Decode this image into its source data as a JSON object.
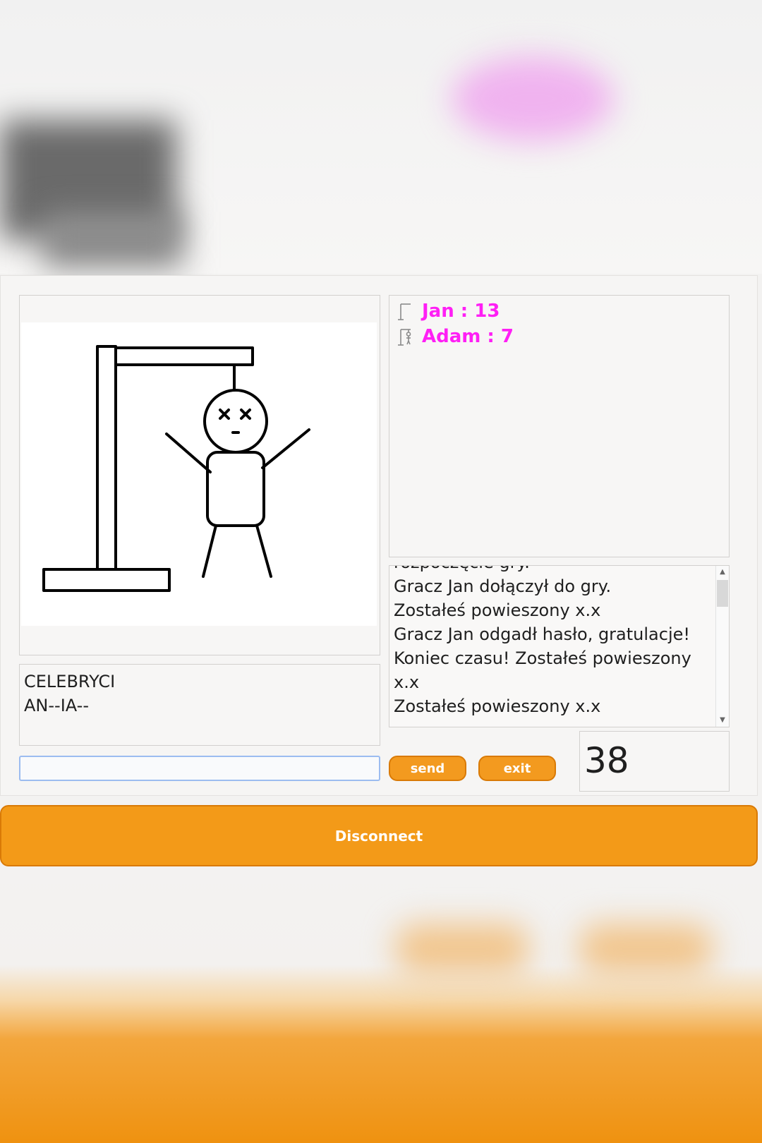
{
  "players": [
    {
      "label": "Jan : 13",
      "icon": "gallows-icon"
    },
    {
      "label": "Adam : 7",
      "icon": "hanged-man-icon"
    }
  ],
  "game_log": [
    "rozpoczęcie gry.",
    "Gracz Jan dołączył do gry.",
    "Zostałeś powieszony x.x",
    "Gracz Jan odgadł hasło, gratulacje!",
    "Koniec czasu! Zostałeś powieszony",
    "x.x",
    "Zostałeś powieszony x.x"
  ],
  "word": {
    "category": "CELEBRYCI",
    "pattern": "AN--IA--"
  },
  "controls": {
    "send_label": "send",
    "exit_label": "exit",
    "guess_value": ""
  },
  "timer": "38",
  "disconnect_label": "Disconnect",
  "colors": {
    "accent": "#f39a18",
    "player_name": "#ff1ff5"
  }
}
